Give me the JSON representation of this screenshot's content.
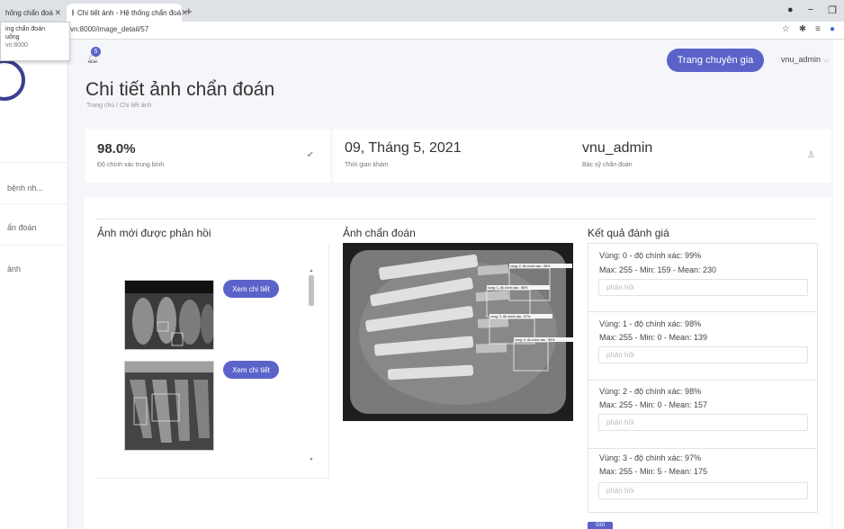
{
  "browser": {
    "tabs": [
      {
        "title": "hống chẩn đoá"
      },
      {
        "title": "Chi tiết ảnh - Hệ thống chẩn đoá"
      }
    ],
    "new_tab": "+",
    "url": "vn:8000/image_detail/57",
    "tooltip": {
      "line1": "ing chẩn đoán",
      "line2": "uống",
      "line3": "vn:8000"
    }
  },
  "topbar": {
    "notification_count": "5",
    "expert_button": "Trang chuyên gia",
    "user": "vnu_admin"
  },
  "sidebar": {
    "items": [
      {
        "label": "bệnh nh..."
      },
      {
        "label": "ẩn đoán"
      },
      {
        "label": "ảnh"
      }
    ]
  },
  "page": {
    "title": "Chi tiết ảnh chẩn đoán",
    "breadcrumb": "Trang chủ  /  Chi tiết ảnh"
  },
  "stats": [
    {
      "value": "98.0%",
      "label": "Độ chính xác trung bình",
      "icon": "check-circle-icon"
    },
    {
      "value": "09, Tháng 5, 2021",
      "label": "Thời gian khám"
    },
    {
      "value": "vnu_admin",
      "label": "Bác sỹ chẩn đoán",
      "icon": "user-icon"
    }
  ],
  "feedback": {
    "title": "Ảnh mới được phản hồi",
    "items": [
      {
        "button": "Xem chi tiết"
      },
      {
        "button": "Xem chi tiết"
      }
    ]
  },
  "diagnosis": {
    "title": "Ảnh chẩn đoán",
    "box_labels": [
      "vùng: 2, độ chính xác : 98%",
      "vùng: 1, độ chính xác : 98%",
      "vùng: 3, độ chính xác : 97%",
      "vùng: 0, độ chính xác : 99%"
    ]
  },
  "results": {
    "title": "Kết quả đánh giá",
    "placeholder": "phản hồi",
    "regions": [
      {
        "line1": "Vùng: 0 - độ chính xác: 99%",
        "line2": "Max: 255 - Min: 159 - Mean: 230"
      },
      {
        "line1": "Vùng: 1 - độ chính xác: 98%",
        "line2": "Max: 255 - Min: 0 - Mean: 139"
      },
      {
        "line1": "Vùng: 2 - độ chính xác: 98%",
        "line2": "Max: 255 - Min: 0 - Mean: 157"
      },
      {
        "line1": "Vùng: 3 - độ chính xác: 97%",
        "line2": "Max: 255 - Min: 5 - Mean: 175"
      }
    ],
    "submit": "Gửi"
  },
  "colors": {
    "accent": "#5b63c9"
  }
}
